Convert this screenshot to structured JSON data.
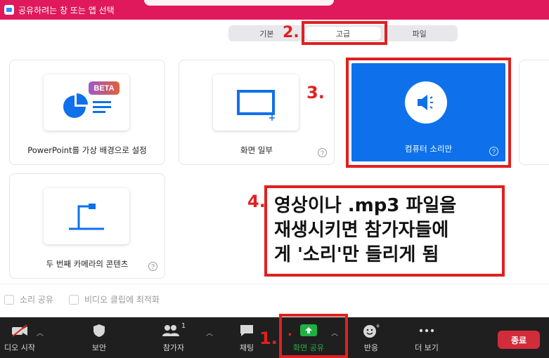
{
  "window": {
    "title": "공유하려는 창 또는 앱 선택"
  },
  "tabs": [
    {
      "label": "기본"
    },
    {
      "label": "고급"
    },
    {
      "label": "파일"
    }
  ],
  "cards": {
    "powerpoint": {
      "label": "PowerPoint를 가상 배경으로 설정",
      "badge": "BETA"
    },
    "portion": {
      "label": "화면 일부"
    },
    "audio": {
      "label": "컴퓨터 소리만"
    },
    "camera": {
      "label": "두 번째 카메라의 콘텐츠"
    }
  },
  "checkboxes": [
    {
      "label": "소리 공유",
      "checked": false
    },
    {
      "label": "비디오 클립에 최적화",
      "checked": false
    }
  ],
  "annotations": {
    "step1": "1.",
    "step1_dot": ".",
    "step2": "2.",
    "step3": "3.",
    "step4": "4.",
    "note_lines": [
      "영상이나 .mp3 파일을",
      "재생시키면 참가자들에",
      "게 '소리'만 들리게 됨"
    ]
  },
  "toolbar": {
    "video": "디오 시작",
    "security": "보안",
    "participants": "참가자",
    "participants_count": "1",
    "chat": "채팅",
    "share": "화면 공유",
    "reactions": "반응",
    "more": "더 보기",
    "end": "종료"
  },
  "colors": {
    "titlebar": "#e0185c",
    "accent": "#0e71eb",
    "annotation": "#e02020",
    "share_green": "#1fb141",
    "end_red": "#d22c3b"
  }
}
